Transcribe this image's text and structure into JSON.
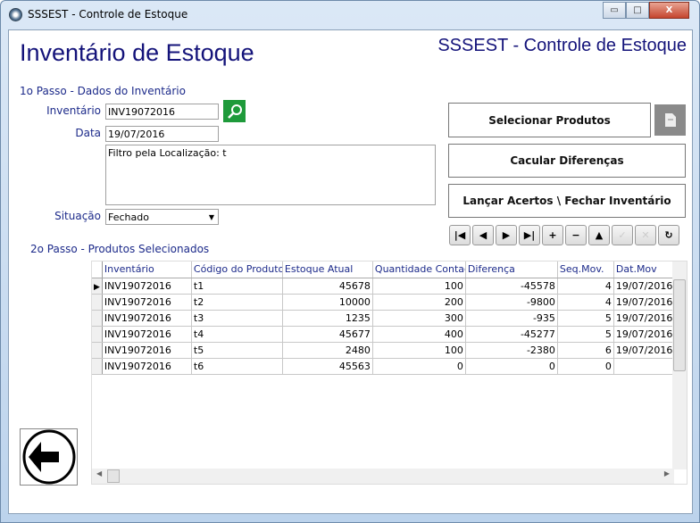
{
  "window": {
    "title": "SSSEST - Controle de Estoque",
    "minimize": "▭",
    "maximize": "□",
    "close": "X"
  },
  "header": {
    "title": "Inventário de Estoque",
    "app_name": "SSSEST - Controle de Estoque"
  },
  "step1": {
    "label": "1o Passo - Dados do Inventário",
    "inventario_label": "Inventário",
    "inventario_value": "INV19072016",
    "data_label": "Data",
    "data_value": "19/07/2016",
    "filtro": "Filtro pela Localização: t",
    "situacao_label": "Situação",
    "situacao_value": "Fechado"
  },
  "actions": {
    "selecionar": "Selecionar Produtos",
    "calcular": "Cacular Diferenças",
    "lancar": "Lançar Acertos \\ Fechar Inventário"
  },
  "navigator": [
    {
      "icon": "first-icon",
      "glyph": "|◀"
    },
    {
      "icon": "prior-icon",
      "glyph": "◀"
    },
    {
      "icon": "next-icon",
      "glyph": "▶"
    },
    {
      "icon": "last-icon",
      "glyph": "▶|"
    },
    {
      "icon": "insert-icon",
      "glyph": "+"
    },
    {
      "icon": "delete-icon",
      "glyph": "−"
    },
    {
      "icon": "edit-icon",
      "glyph": "▲"
    },
    {
      "icon": "post-icon",
      "glyph": "✓",
      "disabled": true
    },
    {
      "icon": "cancel-icon",
      "glyph": "✕",
      "disabled": true
    },
    {
      "icon": "refresh-icon",
      "glyph": "↻"
    }
  ],
  "step2": {
    "label": "2o Passo - Produtos Selecionados"
  },
  "grid": {
    "columns": [
      "Inventário",
      "Código do Produto",
      "Estoque Atual",
      "Quantidade Contada",
      "Diferença",
      "Seq.Mov.",
      "Dat.Mov"
    ],
    "rows": [
      [
        "INV19072016",
        "t1",
        "45678",
        "100",
        "-45578",
        "4",
        "19/07/2016"
      ],
      [
        "INV19072016",
        "t2",
        "10000",
        "200",
        "-9800",
        "4",
        "19/07/2016"
      ],
      [
        "INV19072016",
        "t3",
        "1235",
        "300",
        "-935",
        "5",
        "19/07/2016"
      ],
      [
        "INV19072016",
        "t4",
        "45677",
        "400",
        "-45277",
        "5",
        "19/07/2016"
      ],
      [
        "INV19072016",
        "t5",
        "2480",
        "100",
        "-2380",
        "6",
        "19/07/2016"
      ],
      [
        "INV19072016",
        "t6",
        "45563",
        "0",
        "0",
        "0",
        ""
      ]
    ]
  },
  "colors": {
    "heading": "#14137a",
    "search_button": "#1e9a3a"
  }
}
